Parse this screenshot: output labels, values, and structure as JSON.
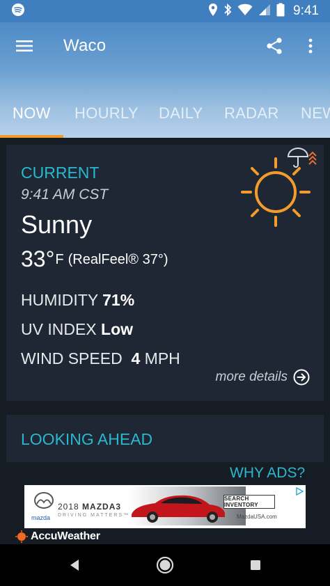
{
  "status_bar": {
    "time": "9:41",
    "icons": [
      "spotify-icon",
      "location-icon",
      "bluetooth-icon",
      "wifi-icon",
      "signal-icon",
      "battery-icon"
    ]
  },
  "app_bar": {
    "title": "Waco",
    "icons": [
      "menu-icon",
      "share-icon",
      "more-vert-icon"
    ]
  },
  "tabs": [
    {
      "label": "NOW",
      "active": true
    },
    {
      "label": "HOURLY",
      "active": false
    },
    {
      "label": "DAILY",
      "active": false
    },
    {
      "label": "RADAR",
      "active": false
    },
    {
      "label": "NEW",
      "active": false
    }
  ],
  "current": {
    "heading": "CURRENT",
    "time": "9:41 AM CST",
    "condition": "Sunny",
    "temperature": "33°",
    "unit": "F",
    "realfeel": "(RealFeel® 37°)",
    "humidity_label": "HUMIDITY",
    "humidity_value": "71%",
    "uv_label": "UV INDEX",
    "uv_value": "Low",
    "wind_label": "WIND SPEED",
    "wind_value": "4",
    "wind_unit": "MPH",
    "more_details": "more details",
    "weather_icon": "sun-icon"
  },
  "looking_ahead": {
    "heading": "LOOKING AHEAD"
  },
  "ads": {
    "why_ads": "WHY ADS?",
    "brand": "mazda",
    "model_year": "2018",
    "model": "MAZDA3",
    "tagline": "DRIVING MATTERS™",
    "cta": "SEARCH INVENTORY",
    "url": "MazdaUSA.com"
  },
  "footer": {
    "brand": "AccuWeather"
  },
  "colors": {
    "accent_teal": "#29b8cf",
    "accent_orange": "#f39c2c",
    "card_bg": "#1e2733",
    "page_bg": "#151c24"
  }
}
